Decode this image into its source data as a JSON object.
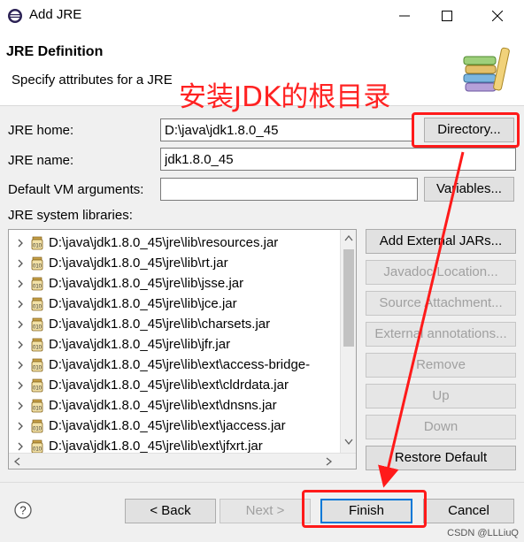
{
  "window": {
    "title": "Add JRE",
    "minimize_icon": "minimize-icon",
    "maximize_icon": "maximize-icon",
    "close_icon": "close-icon"
  },
  "header": {
    "title": "JRE Definition",
    "subtitle": "Specify attributes for a JRE"
  },
  "annotation": {
    "text": "安装JDK的根目录",
    "color": "#ff2222"
  },
  "form": {
    "jre_home_label": "JRE home:",
    "jre_home_value": "D:\\java\\jdk1.8.0_45",
    "directory_button": "Directory...",
    "jre_name_label": "JRE name:",
    "jre_name_value": "jdk1.8.0_45",
    "vm_args_label": "Default VM arguments:",
    "vm_args_value": "",
    "variables_button": "Variables...",
    "libraries_label": "JRE system libraries:"
  },
  "libraries": [
    "D:\\java\\jdk1.8.0_45\\jre\\lib\\resources.jar",
    "D:\\java\\jdk1.8.0_45\\jre\\lib\\rt.jar",
    "D:\\java\\jdk1.8.0_45\\jre\\lib\\jsse.jar",
    "D:\\java\\jdk1.8.0_45\\jre\\lib\\jce.jar",
    "D:\\java\\jdk1.8.0_45\\jre\\lib\\charsets.jar",
    "D:\\java\\jdk1.8.0_45\\jre\\lib\\jfr.jar",
    "D:\\java\\jdk1.8.0_45\\jre\\lib\\ext\\access-bridge-",
    "D:\\java\\jdk1.8.0_45\\jre\\lib\\ext\\cldrdata.jar",
    "D:\\java\\jdk1.8.0_45\\jre\\lib\\ext\\dnsns.jar",
    "D:\\java\\jdk1.8.0_45\\jre\\lib\\ext\\jaccess.jar",
    "D:\\java\\jdk1.8.0_45\\jre\\lib\\ext\\jfxrt.jar"
  ],
  "lib_buttons": {
    "add_external": "Add External JARs...",
    "javadoc": "Javadoc Location...",
    "source": "Source Attachment...",
    "external_annotations": "External annotations...",
    "remove": "Remove",
    "up": "Up",
    "down": "Down",
    "restore": "Restore Default"
  },
  "footer": {
    "back": "< Back",
    "next": "Next >",
    "finish": "Finish",
    "cancel": "Cancel",
    "help_icon": "help-icon"
  },
  "watermark": "CSDN @LLLiuQ"
}
